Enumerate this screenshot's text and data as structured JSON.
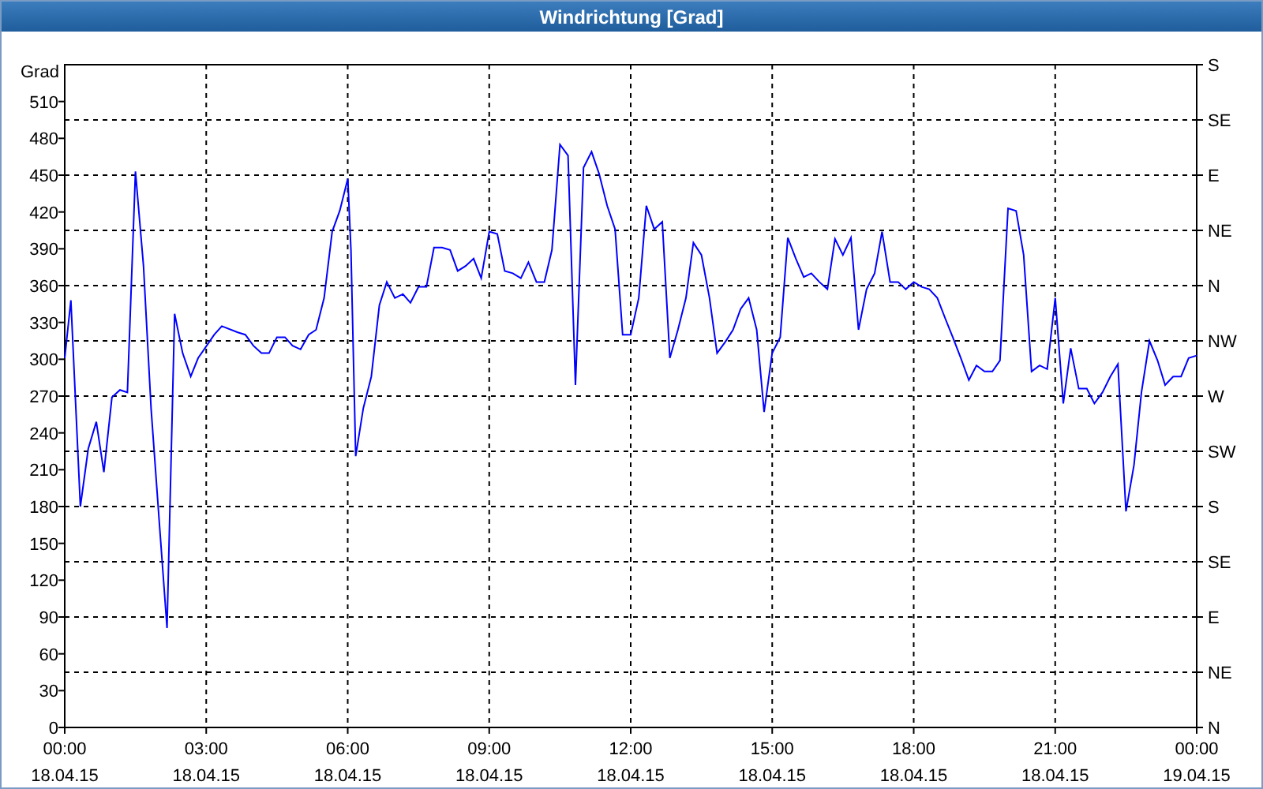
{
  "window": {
    "title": "Windrichtung [Grad]"
  },
  "chart": {
    "left_axis_label": "Grad",
    "date_labels": [
      "18.04.15",
      "18.04.15",
      "18.04.15",
      "18.04.15",
      "18.04.15",
      "18.04.15",
      "18.04.15",
      "18.04.15",
      "19.04.15"
    ],
    "right_ticks": [
      "S",
      "SE",
      "E",
      "NE",
      "N",
      "NW",
      "W",
      "SW",
      "S",
      "SE",
      "E",
      "NE",
      "N"
    ],
    "chart_data": {
      "type": "line",
      "grid": true,
      "xlim": [
        0,
        24
      ],
      "ylim": [
        0,
        540
      ],
      "xticks": [
        {
          "value": 0,
          "label": "00:00"
        },
        {
          "value": 3,
          "label": "03:00"
        },
        {
          "value": 6,
          "label": "06:00"
        },
        {
          "value": 9,
          "label": "09:00"
        },
        {
          "value": 12,
          "label": "12:00"
        },
        {
          "value": 15,
          "label": "15:00"
        },
        {
          "value": 18,
          "label": "18:00"
        },
        {
          "value": 21,
          "label": "21:00"
        },
        {
          "value": 24,
          "label": "00:00"
        }
      ],
      "yticks": [
        0,
        30,
        60,
        90,
        120,
        150,
        180,
        210,
        240,
        270,
        300,
        330,
        360,
        390,
        420,
        450,
        480,
        510
      ],
      "x": [
        0,
        0.13,
        0.33,
        0.5,
        0.67,
        0.83,
        1,
        1.17,
        1.33,
        1.5,
        1.67,
        1.83,
        2,
        2.17,
        2.33,
        2.5,
        2.67,
        2.83,
        3.17,
        3.33,
        3.67,
        3.83,
        4,
        4.17,
        4.33,
        4.5,
        4.67,
        4.83,
        5,
        5.17,
        5.33,
        5.5,
        5.67,
        5.83,
        6,
        6.07,
        6.17,
        6.33,
        6.5,
        6.67,
        6.83,
        7,
        7.17,
        7.33,
        7.5,
        7.67,
        7.83,
        8,
        8.17,
        8.33,
        8.5,
        8.67,
        8.83,
        9,
        9.17,
        9.33,
        9.5,
        9.67,
        9.83,
        10,
        10.17,
        10.33,
        10.5,
        10.67,
        10.83,
        11,
        11.17,
        11.33,
        11.5,
        11.67,
        11.83,
        12,
        12.17,
        12.33,
        12.5,
        12.67,
        12.83,
        13,
        13.17,
        13.33,
        13.5,
        13.67,
        13.83,
        14,
        14.17,
        14.33,
        14.5,
        14.67,
        14.83,
        15,
        15.17,
        15.33,
        15.5,
        15.67,
        15.83,
        16,
        16.17,
        16.33,
        16.5,
        16.67,
        16.83,
        17,
        17.17,
        17.33,
        17.5,
        17.67,
        17.83,
        18,
        18.17,
        18.33,
        18.5,
        18.67,
        18.83,
        19,
        19.17,
        19.33,
        19.5,
        19.67,
        19.83,
        20,
        20.17,
        20.33,
        20.5,
        20.67,
        20.83,
        21,
        21.17,
        21.33,
        21.5,
        21.67,
        21.83,
        22,
        22.17,
        22.33,
        22.5,
        22.67,
        22.83,
        23,
        23.17,
        23.33,
        23.5,
        23.67,
        23.83,
        24
      ],
      "series": [
        {
          "color": "#0000ff",
          "values": [
            301,
            348,
            180,
            227,
            249,
            208,
            269,
            275,
            273,
            453,
            376,
            260,
            169,
            81,
            337,
            305,
            286,
            301,
            320,
            327,
            322,
            320,
            311,
            305,
            305,
            318,
            318,
            311,
            308,
            320,
            324,
            350,
            404,
            421,
            447,
            389,
            221,
            260,
            286,
            344,
            363,
            350,
            353,
            346,
            359,
            359,
            391,
            391,
            389,
            372,
            376,
            382,
            366,
            404,
            402,
            372,
            370,
            366,
            379,
            363,
            363,
            389,
            475,
            466,
            279,
            456,
            469,
            451,
            425,
            406,
            320,
            320,
            350,
            425,
            406,
            412,
            301,
            324,
            350,
            395,
            385,
            350,
            305,
            314,
            324,
            341,
            350,
            324,
            257,
            305,
            318,
            399,
            382,
            367,
            370,
            363,
            357,
            398,
            385,
            399,
            324,
            357,
            370,
            404,
            363,
            363,
            357,
            363,
            359,
            357,
            350,
            333,
            318,
            301,
            283,
            295,
            290,
            290,
            299,
            423,
            421,
            385,
            290,
            295,
            292,
            350,
            264,
            309,
            276,
            276,
            264,
            273,
            286,
            296,
            176,
            214,
            273,
            315,
            299,
            279,
            286,
            286,
            301,
            303
          ]
        }
      ]
    }
  }
}
